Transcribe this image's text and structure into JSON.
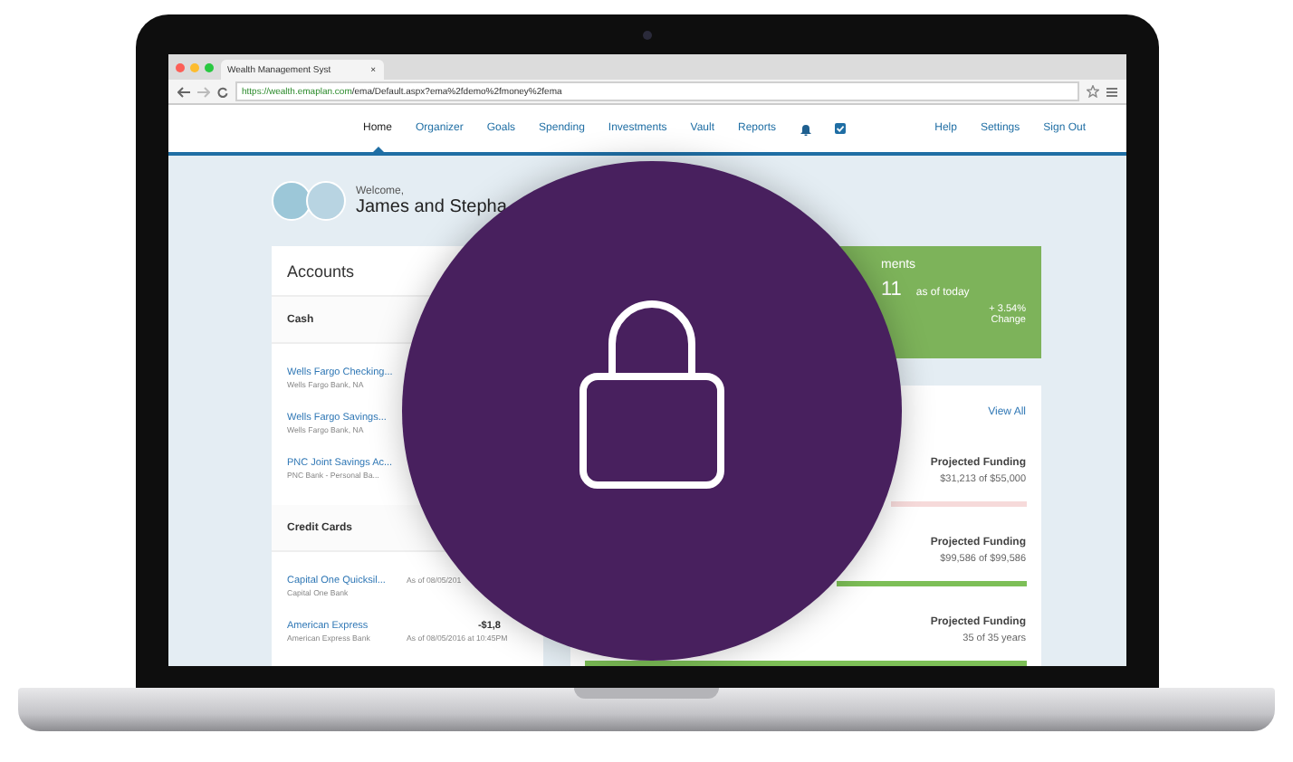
{
  "browser": {
    "tab_title": "Wealth Management Syst",
    "tab_close": "×",
    "url_host": "https://wealth.emaplan.com",
    "url_path": "/ema/Default.aspx?ema%2fdemo%2fmoney%2fema"
  },
  "nav": {
    "items": [
      {
        "label": "Home",
        "selected": true
      },
      {
        "label": "Organizer",
        "selected": false
      },
      {
        "label": "Goals",
        "selected": false
      },
      {
        "label": "Spending",
        "selected": false
      },
      {
        "label": "Investments",
        "selected": false
      },
      {
        "label": "Vault",
        "selected": false
      },
      {
        "label": "Reports",
        "selected": false
      }
    ],
    "right": [
      "Help",
      "Settings",
      "Sign Out"
    ]
  },
  "welcome": {
    "greeting": "Welcome,",
    "names": "James and Stepha"
  },
  "accounts": {
    "title": "Accounts",
    "groups": [
      {
        "title": "Cash",
        "items": [
          {
            "name": "Wells Fargo Checking...",
            "institution": "Wells Fargo Bank, NA"
          },
          {
            "name": "Wells Fargo Savings...",
            "institution": "Wells Fargo Bank, NA"
          },
          {
            "name": "PNC Joint Savings Ac...",
            "institution": "PNC Bank - Personal Ba..."
          }
        ]
      },
      {
        "title": "Credit Cards",
        "items": [
          {
            "name": "Capital One Quicksil...",
            "institution": "Capital One Bank",
            "as_of": "As of 08/05/201"
          },
          {
            "name": "American Express",
            "institution": "American Express Bank",
            "amount": "-$1,8",
            "as_of": "As of 08/05/2016 at 10:45PM"
          }
        ]
      }
    ]
  },
  "investments": {
    "title": "ments",
    "value": "11",
    "as_of": "as of today",
    "change": "+ 3.54%",
    "change_label": "Change"
  },
  "goals": {
    "link": "View All",
    "rows": [
      {
        "label": "Projected Funding",
        "detail": "$31,213 of $55,000",
        "level": 1,
        "color": "#f6dada"
      },
      {
        "label": "Projected Funding",
        "detail": "$99,586 of $99,586",
        "level": 1,
        "color": "#7dbf57"
      },
      {
        "label": "Projected Funding",
        "detail": "35 of 35 years",
        "level": 1,
        "color": "#7dbf57"
      }
    ]
  }
}
